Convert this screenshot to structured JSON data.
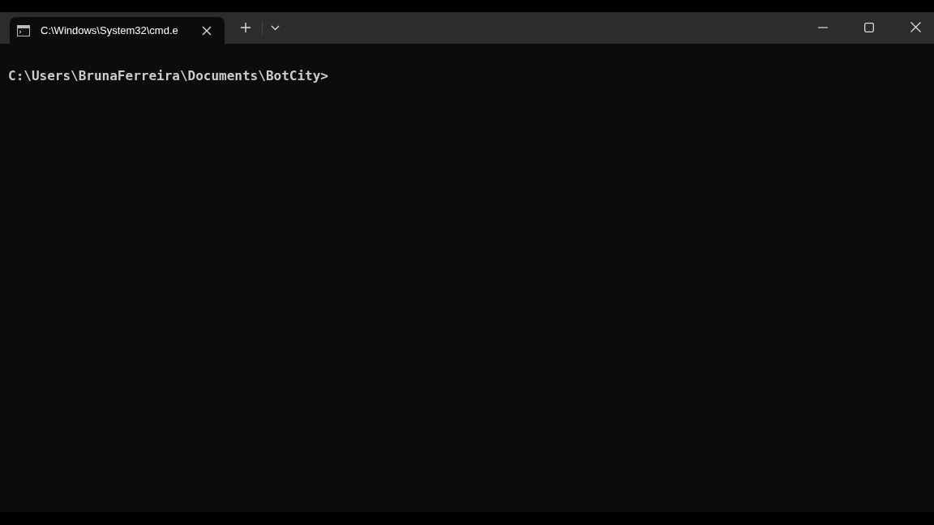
{
  "window": {
    "tab": {
      "title": "C:\\Windows\\System32\\cmd.e",
      "selected": true
    }
  },
  "terminal": {
    "lines": [
      "C:\\Users\\BrunaFerreira\\Documents\\BotCity>"
    ]
  }
}
